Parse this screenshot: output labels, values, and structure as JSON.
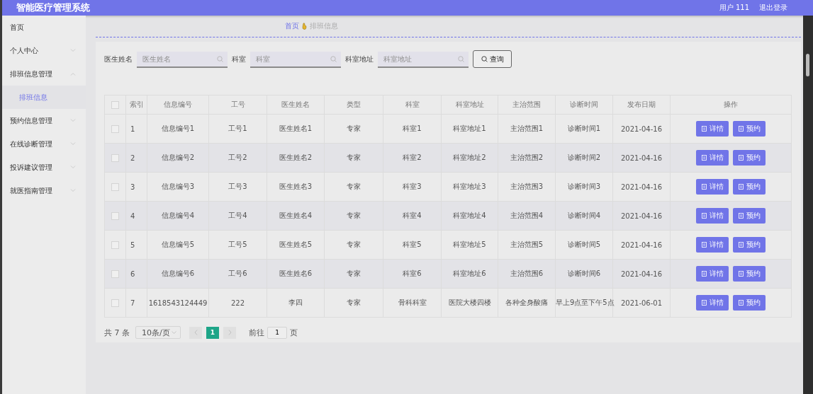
{
  "header": {
    "title": "智能医疗管理系统",
    "user": "用户 111",
    "logout": "退出登录"
  },
  "sidebar": {
    "items": [
      {
        "label": "首页",
        "expandable": false,
        "selected": false
      },
      {
        "label": "个人中心",
        "expandable": true,
        "expanded": false,
        "selected": false
      },
      {
        "label": "排班信息管理",
        "expandable": true,
        "expanded": true,
        "selected": false,
        "children": [
          {
            "label": "排班信息",
            "selected": true
          }
        ]
      },
      {
        "label": "预约信息管理",
        "expandable": true,
        "expanded": false,
        "selected": false
      },
      {
        "label": "在线诊断管理",
        "expandable": true,
        "expanded": false,
        "selected": false
      },
      {
        "label": "投诉建议管理",
        "expandable": true,
        "expanded": false,
        "selected": false
      },
      {
        "label": "就医指南管理",
        "expandable": true,
        "expanded": false,
        "selected": false
      }
    ]
  },
  "breadcrumb": [
    "首页",
    "排班信息"
  ],
  "search": {
    "fields": [
      {
        "label": "医生姓名",
        "placeholder": "医生姓名"
      },
      {
        "label": "科室",
        "placeholder": "科室"
      },
      {
        "label": "科室地址",
        "placeholder": "科室地址"
      }
    ],
    "button": "查询"
  },
  "table": {
    "columns": [
      "索引",
      "信息编号",
      "工号",
      "医生姓名",
      "类型",
      "科室",
      "科室地址",
      "主治范围",
      "诊断时间",
      "发布日期",
      "操作"
    ],
    "all_checked": false,
    "rows": [
      {
        "checked": false,
        "cells": [
          "1",
          "信息编号1",
          "工号1",
          "医生姓名1",
          "专家",
          "科室1",
          "科室地址1",
          "主治范围1",
          "诊断时间1",
          "2021-04-16"
        ],
        "actions": [
          "详情",
          "预约"
        ]
      },
      {
        "checked": false,
        "cells": [
          "2",
          "信息编号2",
          "工号2",
          "医生姓名2",
          "专家",
          "科室2",
          "科室地址2",
          "主治范围2",
          "诊断时间2",
          "2021-04-16"
        ],
        "actions": [
          "详情",
          "预约"
        ]
      },
      {
        "checked": false,
        "cells": [
          "3",
          "信息编号3",
          "工号3",
          "医生姓名3",
          "专家",
          "科室3",
          "科室地址3",
          "主治范围3",
          "诊断时间3",
          "2021-04-16"
        ],
        "actions": [
          "详情",
          "预约"
        ]
      },
      {
        "checked": false,
        "cells": [
          "4",
          "信息编号4",
          "工号4",
          "医生姓名4",
          "专家",
          "科室4",
          "科室地址4",
          "主治范围4",
          "诊断时间4",
          "2021-04-16"
        ],
        "actions": [
          "详情",
          "预约"
        ]
      },
      {
        "checked": false,
        "cells": [
          "5",
          "信息编号5",
          "工号5",
          "医生姓名5",
          "专家",
          "科室5",
          "科室地址5",
          "主治范围5",
          "诊断时间5",
          "2021-04-16"
        ],
        "actions": [
          "详情",
          "预约"
        ]
      },
      {
        "checked": false,
        "cells": [
          "6",
          "信息编号6",
          "工号6",
          "医生姓名6",
          "专家",
          "科室6",
          "科室地址6",
          "主治范围6",
          "诊断时间6",
          "2021-04-16"
        ],
        "actions": [
          "详情",
          "预约"
        ]
      },
      {
        "checked": false,
        "cells": [
          "7",
          "1618543124449",
          "222",
          "李四",
          "专家",
          "骨科科室",
          "医院大楼四楼",
          "各种全身酸痛",
          "早上9点至下午5点",
          "2021-06-01"
        ],
        "actions": [
          "详情",
          "预约"
        ]
      }
    ]
  },
  "pagination": {
    "total": "共 7 条",
    "page_size": "10条/页",
    "pages": [
      {
        "label": "1",
        "selected": true
      }
    ],
    "goto_label": "前往",
    "goto_value": "1",
    "goto_suffix": "页"
  }
}
